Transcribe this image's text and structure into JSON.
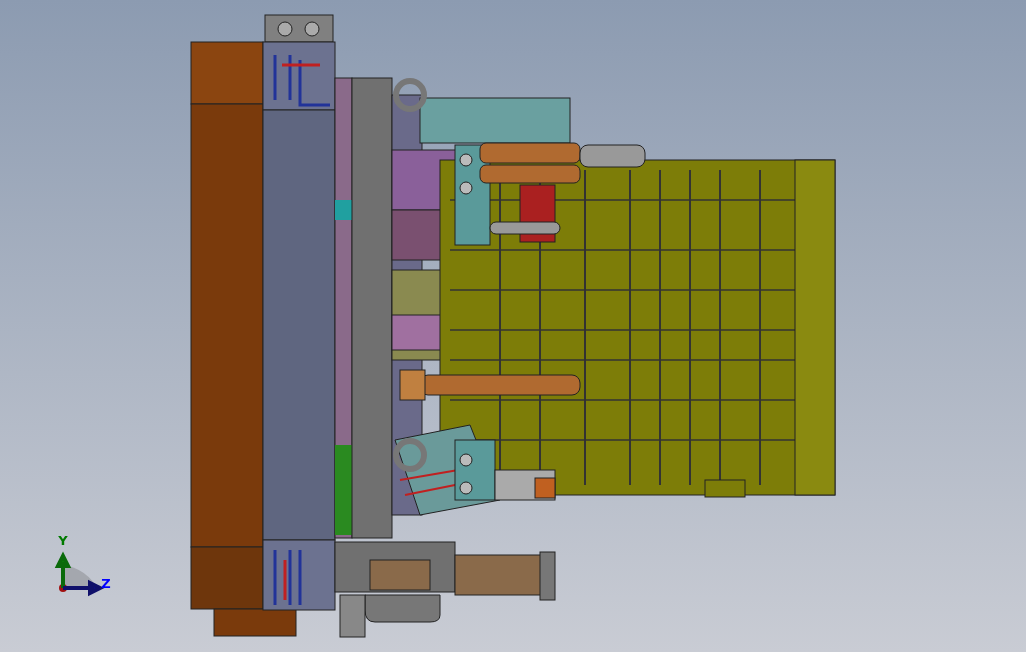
{
  "viewport": {
    "axes": [
      {
        "label": "Y",
        "color": "#007a00"
      },
      {
        "label": "Z",
        "color": "#0000ff"
      }
    ]
  }
}
